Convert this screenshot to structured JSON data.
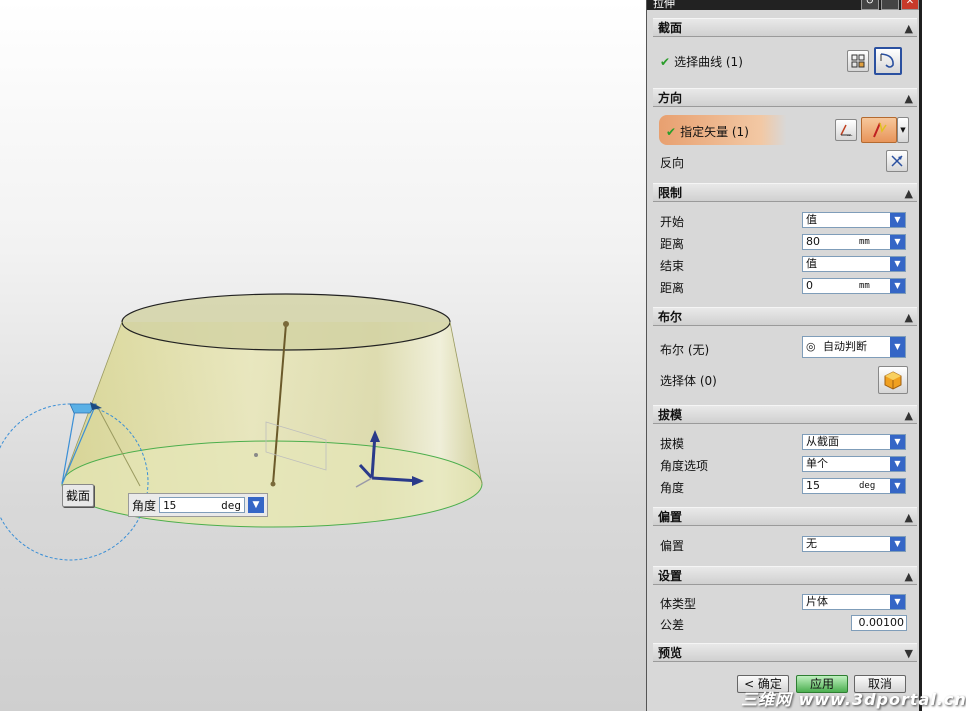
{
  "viewport": {
    "section_label": "截面",
    "angle_field": {
      "label": "角度",
      "value": "15",
      "unit": "deg"
    }
  },
  "dialog": {
    "title": "拉伸",
    "title_buttons": [
      "↺",
      "",
      "✕"
    ],
    "sections": {
      "section": {
        "header": "截面",
        "select_curve": "选择曲线 (1)"
      },
      "direction": {
        "header": "方向",
        "specify_vector": "指定矢量 (1)",
        "reverse": "反向"
      },
      "limits": {
        "header": "限制",
        "start_label": "开始",
        "start_value": "值",
        "distance1_label": "距离",
        "distance1_value": "80",
        "distance1_unit": "mm",
        "end_label": "结束",
        "end_value": "值",
        "distance2_label": "距离",
        "distance2_value": "0",
        "distance2_unit": "mm"
      },
      "boolean": {
        "header": "布尔",
        "boolean_label": "布尔 (无)",
        "boolean_value": "自动判断",
        "select_body": "选择体 (0)"
      },
      "draft": {
        "header": "拔模",
        "draft_label": "拔模",
        "draft_value": "从截面",
        "angle_option_label": "角度选项",
        "angle_option_value": "单个",
        "angle_label": "角度",
        "angle_value": "15",
        "angle_unit": "deg"
      },
      "offset": {
        "header": "偏置",
        "offset_label": "偏置",
        "offset_value": "无"
      },
      "settings": {
        "header": "设置",
        "body_type_label": "体类型",
        "body_type_value": "片体",
        "tolerance_label": "公差",
        "tolerance_value": "0.00100"
      },
      "preview": {
        "header": "预览"
      }
    },
    "buttons": {
      "ok": "< 确定 >",
      "apply": "应用",
      "cancel": "取消"
    }
  },
  "watermark": "三维网 www.3dportal.cn",
  "colors": {
    "accent_blue": "#3566c6",
    "check_green": "#2a9d2a",
    "highlight_orange": "#e8a070",
    "apply_green": "#4caf50"
  }
}
